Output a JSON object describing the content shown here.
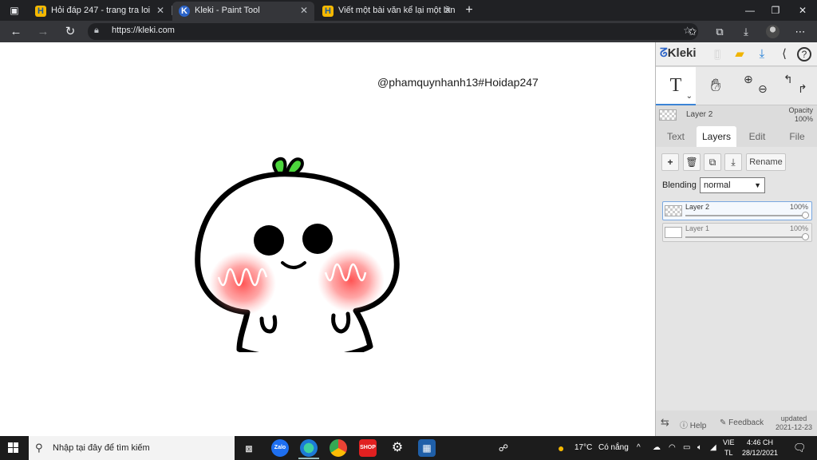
{
  "browser": {
    "tabs": [
      {
        "title": "Hỏi đáp 247 - trang tra loi",
        "favicon": "H",
        "active": false
      },
      {
        "title": "Kleki - Paint Tool",
        "favicon": "K",
        "active": true
      },
      {
        "title": "Viết một bài văn kể lại một lần e",
        "favicon": "H",
        "active": false
      }
    ],
    "new_tab": "+",
    "url": "https://kleki.com"
  },
  "canvas": {
    "watermark": "@phamquynhanh13#Hoidap247"
  },
  "panel": {
    "logo": "Kleki",
    "layer_info": {
      "name": "Layer 2",
      "opacity_label": "Opacity",
      "opacity_value": "100%"
    },
    "tabs": [
      "Text",
      "Layers",
      "Edit",
      "File"
    ],
    "active_tab": "Layers",
    "rename_label": "Rename",
    "blending_label": "Blending",
    "blending_value": "normal",
    "layers": [
      {
        "name": "Layer 2",
        "opacity": "100%",
        "selected": true
      },
      {
        "name": "Layer 1",
        "opacity": "100%",
        "selected": false
      }
    ],
    "bottom": {
      "help": "Help",
      "feedback": "Feedback",
      "updated_label": "updated",
      "updated_date": "2021-12-23"
    }
  },
  "taskbar": {
    "search_placeholder": "Nhập tại đây để tìm kiếm",
    "weather_temp": "17°C",
    "weather_text": "Có nắng",
    "lang_top": "VIE",
    "lang_bottom": "TL",
    "time": "4:46 CH",
    "date": "28/12/2021"
  },
  "colors": {
    "accent": "#3c84d6",
    "sprout": "#4cd63c",
    "blush": "#ff5a5a"
  }
}
